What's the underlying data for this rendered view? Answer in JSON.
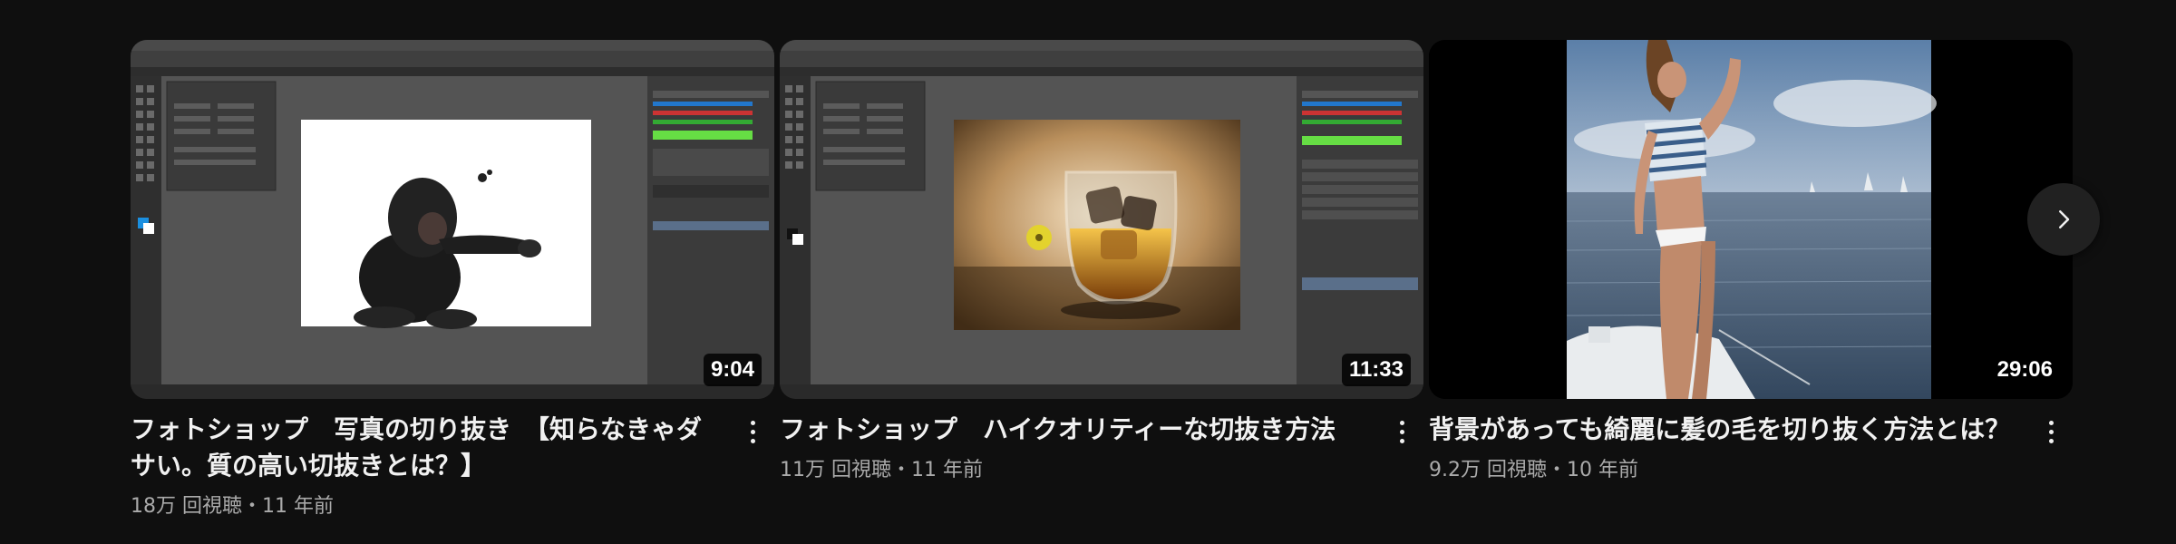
{
  "videos": [
    {
      "title": "フォトショップ　写真の切り抜き　【知らなきゃダサい。質の高い切抜きとは？】",
      "stats": "18万 回視聴・11 年前",
      "duration": "9:04"
    },
    {
      "title": "フォトショップ　ハイクオリティーな切抜き方法",
      "stats": "11万 回視聴・11 年前",
      "duration": "11:33"
    },
    {
      "title": "背景があっても綺麗に髪の毛を切り抜く方法とは？",
      "stats": "9.2万 回視聴・10 年前",
      "duration": "29:06"
    }
  ],
  "icons": {
    "more": "vertical-ellipsis-icon",
    "next": "chevron-right-icon"
  },
  "colors": {
    "background": "#0f0f0f",
    "title": "#f1f1f1",
    "stats": "#aaaaaa",
    "next_button": "#212121"
  }
}
